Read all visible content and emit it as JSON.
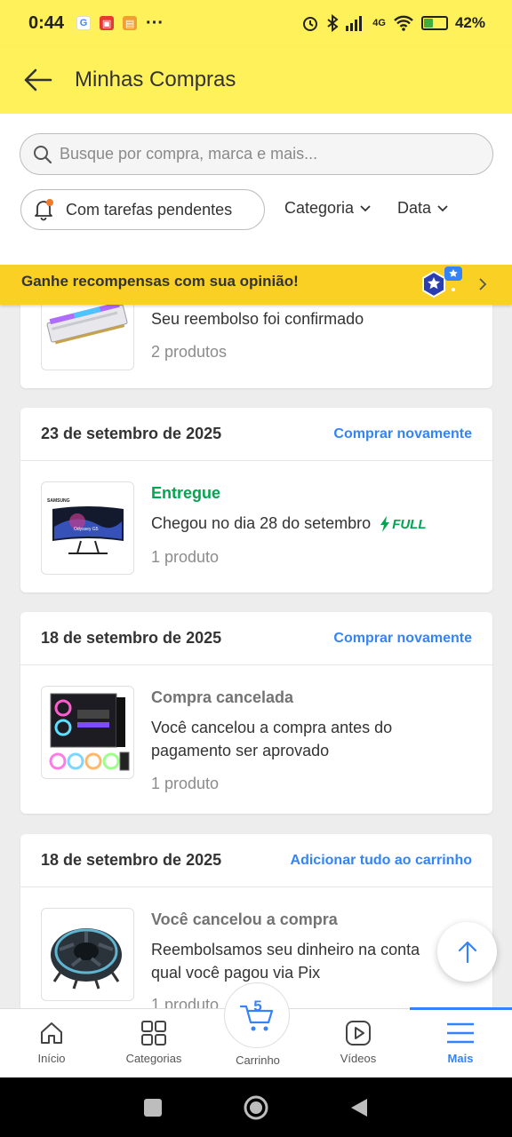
{
  "status_bar": {
    "time": "0:44",
    "more": "···",
    "network": "4G",
    "battery_percent": "42%",
    "battery_level": 0.42
  },
  "header": {
    "title": "Minhas Compras"
  },
  "search": {
    "placeholder": "Busque por compra, marca e mais..."
  },
  "filters": {
    "pending_chip": "Com tarefas pendentes",
    "category": "Categoria",
    "date": "Data"
  },
  "banner": {
    "text": "Ganhe recompensas com sua opinião!"
  },
  "orders": [
    {
      "status": "",
      "line1": "Seu reembolso foi confirmado",
      "count": "2 produtos",
      "product_icon": "ram-memory-image"
    },
    {
      "date": "23 de setembro de 2025",
      "action": "Comprar novamente",
      "status": "Entregue",
      "line1": "Chegou no dia 28 do setembro",
      "badge": "FULL",
      "count": "1 produto",
      "product_icon": "monitor-image",
      "product_brand": "SAMSUNG",
      "product_model": "Odyssey G5"
    },
    {
      "date": "18 de setembro de 2025",
      "action": "Comprar novamente",
      "status": "Compra cancelada",
      "line1": "Você cancelou a compra antes do",
      "line2": "pagamento ser aprovado",
      "count": "1 produto",
      "product_icon": "pc-case-image"
    },
    {
      "date": "18 de setembro de 2025",
      "action": "Adicionar tudo ao carrinho",
      "status": "Você cancelou a compra",
      "line1": "Reembolsamos seu dinheiro na conta",
      "line2": "qual você pagou via Pix",
      "count": "1 produto",
      "product_icon": "cpu-cooler-image"
    }
  ],
  "bottom_nav": {
    "items": [
      {
        "label": "Início",
        "icon": "home-icon"
      },
      {
        "label": "Categorias",
        "icon": "grid-icon"
      },
      {
        "label": "Carrinho",
        "icon": "cart-icon",
        "count": "5"
      },
      {
        "label": "Vídeos",
        "icon": "play-icon"
      },
      {
        "label": "Mais",
        "icon": "menu-icon",
        "active": true
      }
    ]
  },
  "colors": {
    "brand_yellow": "#fff159",
    "banner_yellow": "#fbd024",
    "link_blue": "#3483fa",
    "success_green": "#00a650"
  }
}
